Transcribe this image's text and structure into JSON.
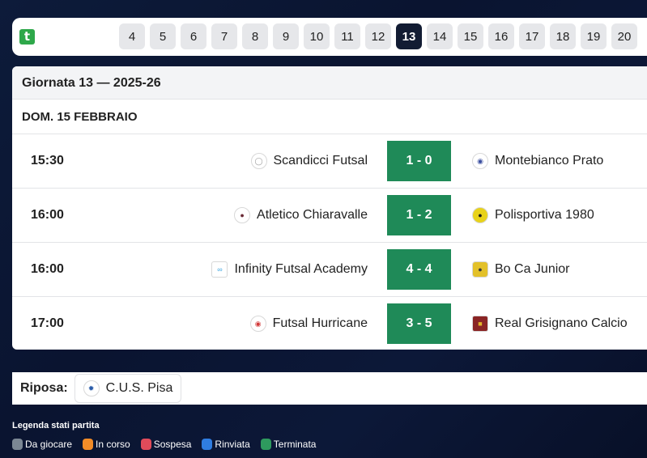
{
  "rounds": [
    "4",
    "5",
    "6",
    "7",
    "8",
    "9",
    "10",
    "11",
    "12",
    "13",
    "14",
    "15",
    "16",
    "17",
    "18",
    "19",
    "20"
  ],
  "active_round": "13",
  "logo_letter": "t",
  "header": {
    "title": "Giornata 13 — 2025-26"
  },
  "date_label": "DOM. 15 FEBBRAIO",
  "matches": [
    {
      "time": "15:30",
      "home": "Scandicci Futsal",
      "score": "1 - 0",
      "away": "Montebianco Prato"
    },
    {
      "time": "16:00",
      "home": "Atletico Chiaravalle",
      "score": "1 - 2",
      "away": "Polisportiva 1980"
    },
    {
      "time": "16:00",
      "home": "Infinity Futsal Academy",
      "score": "4 - 4",
      "away": "Bo Ca Junior"
    },
    {
      "time": "17:00",
      "home": "Futsal Hurricane",
      "score": "3 - 5",
      "away": "Real Grisignano Calcio"
    }
  ],
  "bye": {
    "label": "Riposa:",
    "team": "C.U.S. Pisa"
  },
  "legend": {
    "title": "Legenda stati partita",
    "items": [
      {
        "label": "Da giocare",
        "color": "#7b8794"
      },
      {
        "label": "In corso",
        "color": "#f28c28"
      },
      {
        "label": "Sospesa",
        "color": "#e04b5a"
      },
      {
        "label": "Rinviata",
        "color": "#2f7de1"
      },
      {
        "label": "Terminata",
        "color": "#2e9a5e"
      }
    ]
  },
  "colors": {
    "score_bg": "#1f8a58",
    "active_round_bg": "#121c33"
  }
}
